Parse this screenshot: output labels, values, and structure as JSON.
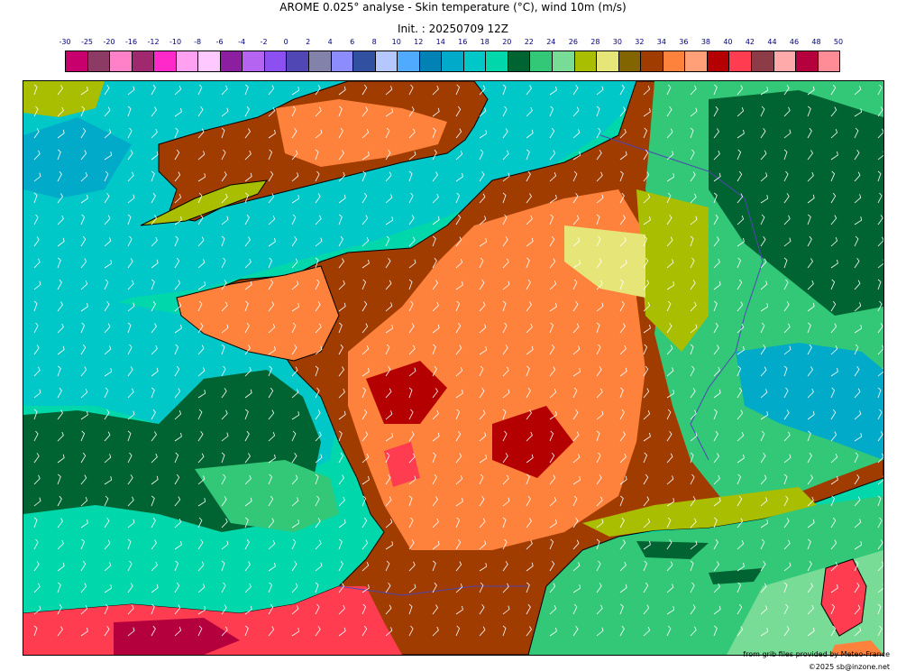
{
  "title": "AROME 0.025° analyse - Skin temperature (°C), wind 10m (m/s)",
  "subtitle": "Init. : 20250709 12Z",
  "colorbar": {
    "ticks": [
      "-30",
      "-25",
      "-20",
      "-16",
      "-12",
      "-10",
      "-8",
      "-6",
      "-4",
      "-2",
      "0",
      "2",
      "4",
      "6",
      "8",
      "10",
      "12",
      "14",
      "16",
      "18",
      "20",
      "22",
      "24",
      "26",
      "28",
      "30",
      "32",
      "34",
      "36",
      "38",
      "40",
      "42",
      "44",
      "46",
      "48",
      "50"
    ],
    "colors": [
      "#c8006e",
      "#8c3c64",
      "#ff82c8",
      "#a0286e",
      "#ff28c8",
      "#ffa0f0",
      "#ffc8ff",
      "#8c1ea0",
      "#b464f0",
      "#8c50f0",
      "#5046b4",
      "#8282aa",
      "#8c8cff",
      "#3250a0",
      "#b4c8ff",
      "#50aaff",
      "#0082b4",
      "#00aac8",
      "#00c8c8",
      "#00d7aa",
      "#006432",
      "#32c878",
      "#78dc96",
      "#aabe00",
      "#e6e678",
      "#826400",
      "#a03c00",
      "#ff823c",
      "#ffa078",
      "#b40000",
      "#ff3c50",
      "#8c3c46",
      "#ffaaaa",
      "#b4003c",
      "#ff8c96"
    ]
  },
  "map": {
    "region": "France",
    "colors": {
      "sea_west": "#00d7aa",
      "sea_cyan": "#00c8c8",
      "sea_blue": "#00aac8",
      "deep_green": "#006432",
      "mid_green": "#32c878",
      "light_green": "#78dc96",
      "olive": "#aabe00",
      "yellow": "#e6e678",
      "brown": "#a03c00",
      "orange": "#ff823c",
      "red": "#b40000",
      "pink": "#ff3c50",
      "wind_barb": "#ffffff",
      "coastline": "#000000",
      "border": "#5046b4"
    }
  },
  "credits": {
    "line1": "from grib files provided by Meteo-France",
    "line2": "©2025 sb@inzone.net"
  }
}
